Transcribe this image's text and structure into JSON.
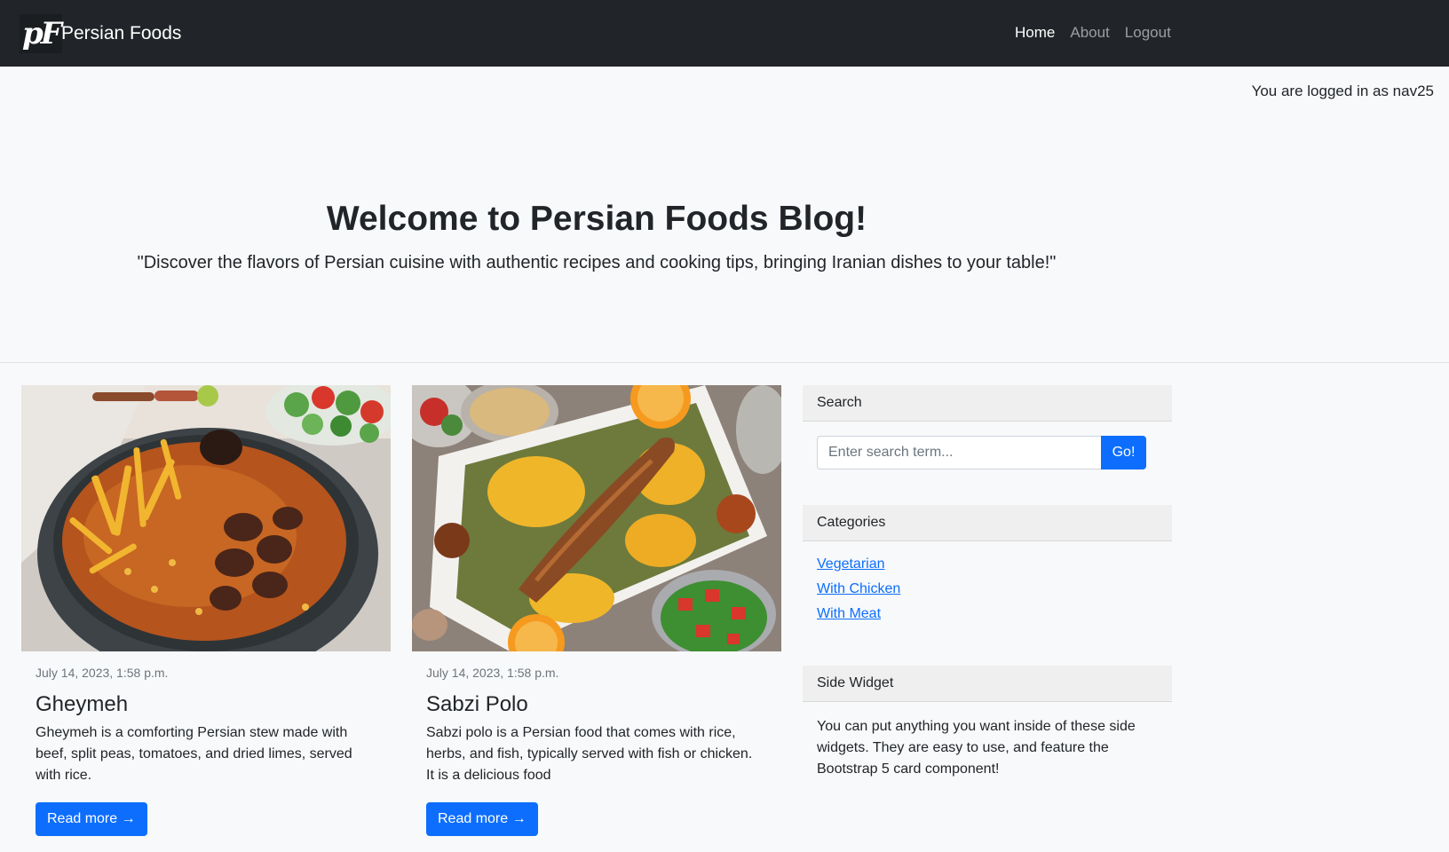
{
  "navbar": {
    "brand_logo": "pF",
    "brand_name": "Persian Foods",
    "links": [
      {
        "label": "Home",
        "active": true
      },
      {
        "label": "About",
        "active": false
      },
      {
        "label": "Logout",
        "active": false
      }
    ]
  },
  "user_status": "You are logged in as nav25",
  "hero": {
    "title": "Welcome to Persian Foods Blog!",
    "subtitle": "\"Discover the flavors of Persian cuisine with authentic recipes and cooking tips, bringing Iranian dishes to your table!\""
  },
  "posts": [
    {
      "date": "July 14, 2023, 1:58 p.m.",
      "title": "Gheymeh",
      "excerpt": "Gheymeh is a comforting Persian stew made with beef, split peas, tomatoes, and dried limes, served with rice.",
      "button": "Read more →"
    },
    {
      "date": "July 14, 2023, 1:58 p.m.",
      "title": "Sabzi Polo",
      "excerpt": "Sabzi polo is a Persian food that comes with rice, herbs, and fish, typically served with fish or chicken. It is a delicious food",
      "button": "Read more →"
    }
  ],
  "sidebar": {
    "search": {
      "header": "Search",
      "placeholder": "Enter search term...",
      "button": "Go!"
    },
    "categories": {
      "header": "Categories",
      "items": [
        "Vegetarian",
        "With Chicken",
        "With Meat"
      ]
    },
    "side_widget": {
      "header": "Side Widget",
      "text": "You can put anything you want inside of these side widgets. They are easy to use, and feature the Bootstrap 5 card component!"
    }
  },
  "colors": {
    "navbar": "#212529",
    "primary": "#0d6efd",
    "page_bg": "#f8f9fa"
  }
}
